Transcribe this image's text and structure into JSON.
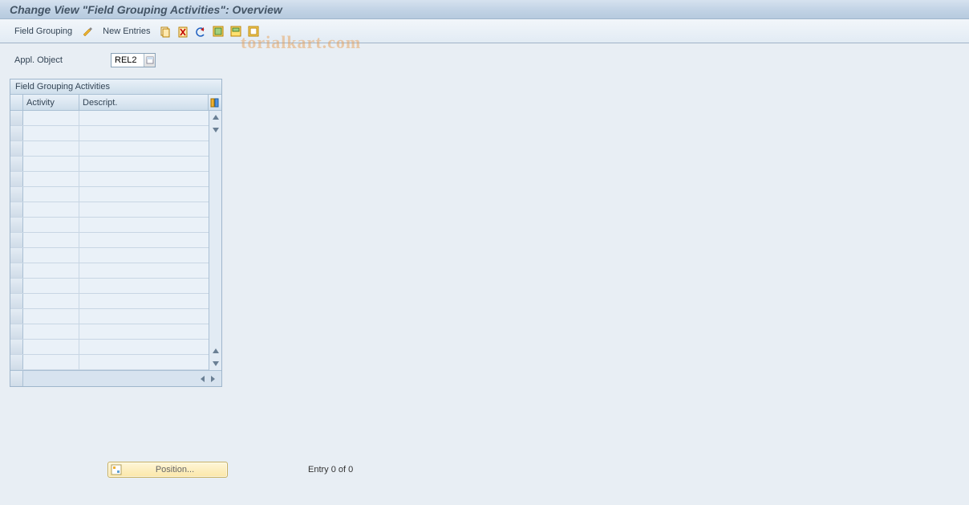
{
  "title": "Change View \"Field Grouping Activities\": Overview",
  "toolbar": {
    "field_grouping": "Field Grouping",
    "new_entries": "New Entries"
  },
  "watermark": "torialkart.com",
  "appl_object": {
    "label": "Appl. Object",
    "value": "REL2"
  },
  "table": {
    "title": "Field Grouping Activities",
    "columns": {
      "activity": "Activity",
      "descript": "Descript."
    },
    "row_count": 17
  },
  "position_button": "Position...",
  "entry_count": "Entry 0 of 0"
}
